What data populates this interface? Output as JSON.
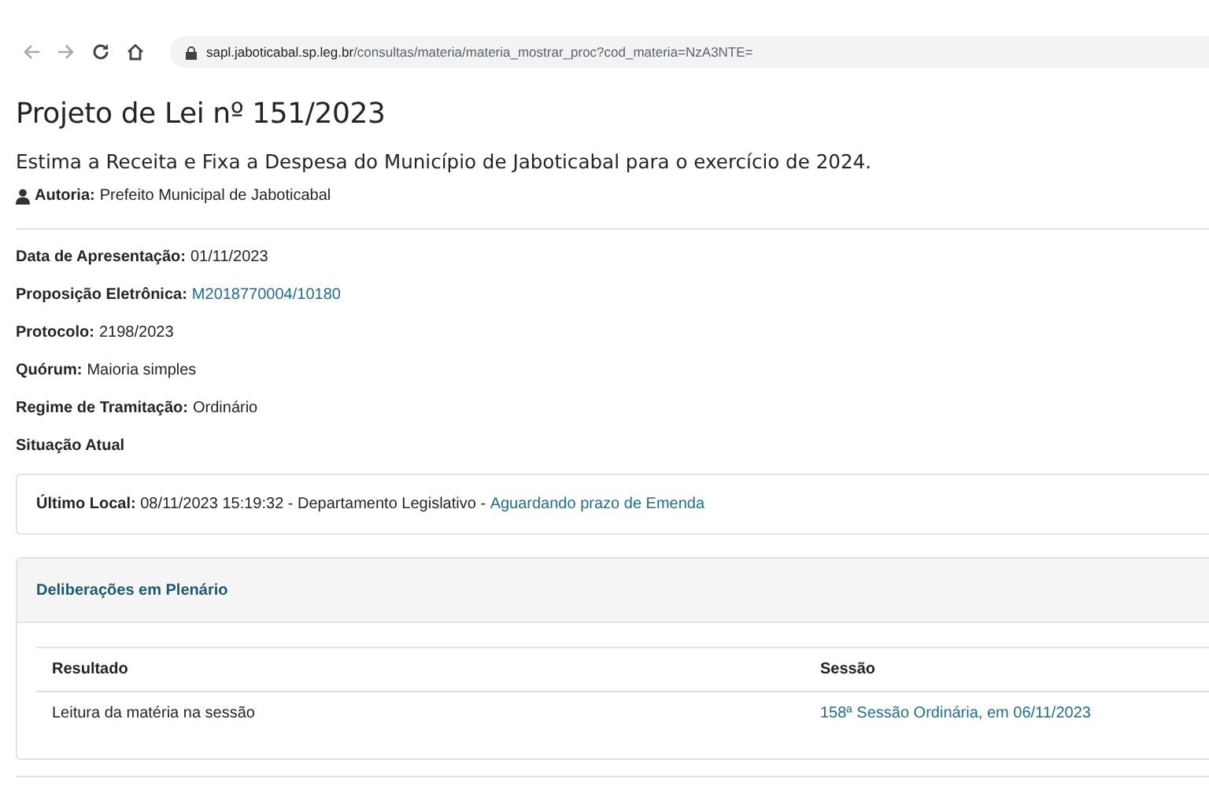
{
  "browser": {
    "url_host": "sapl.jaboticabal.sp.leg.br",
    "url_path": "/consultas/materia/materia_mostrar_proc?cod_materia=NzA3NTE="
  },
  "title": "Projeto de Lei nº 151/2023",
  "summary": "Estima a Receita e Fixa a Despesa do Município de Jaboticabal para o exercício de 2024.",
  "author": {
    "label": "Autoria:",
    "value": "Prefeito Municipal de Jaboticabal"
  },
  "fields": [
    {
      "label": "Data de Apresentação:",
      "value": "01/11/2023",
      "kind": "text"
    },
    {
      "label": "Proposição Eletrônica:",
      "value": "M2018770004/10180",
      "kind": "link"
    },
    {
      "label": "Protocolo:",
      "value": "2198/2023",
      "kind": "text"
    },
    {
      "label": "Quórum:",
      "value": "Maioria simples",
      "kind": "text"
    },
    {
      "label": "Regime de Tramitação:",
      "value": "Ordinário",
      "kind": "text"
    },
    {
      "label": "Situação Atual",
      "kind": "heading"
    }
  ],
  "last_location": {
    "label": "Último Local:",
    "text": "08/11/2023 15:19:32 - Departamento Legislativo -",
    "link": "Aguardando prazo de Emenda"
  },
  "deliberations": {
    "title": "Deliberações em Plenário",
    "columns": [
      "Resultado",
      "Sessão"
    ],
    "rows": [
      {
        "result": "Leitura da matéria na sessão",
        "session": "158ª Sessão Ordinária, em 06/11/2023"
      }
    ]
  }
}
